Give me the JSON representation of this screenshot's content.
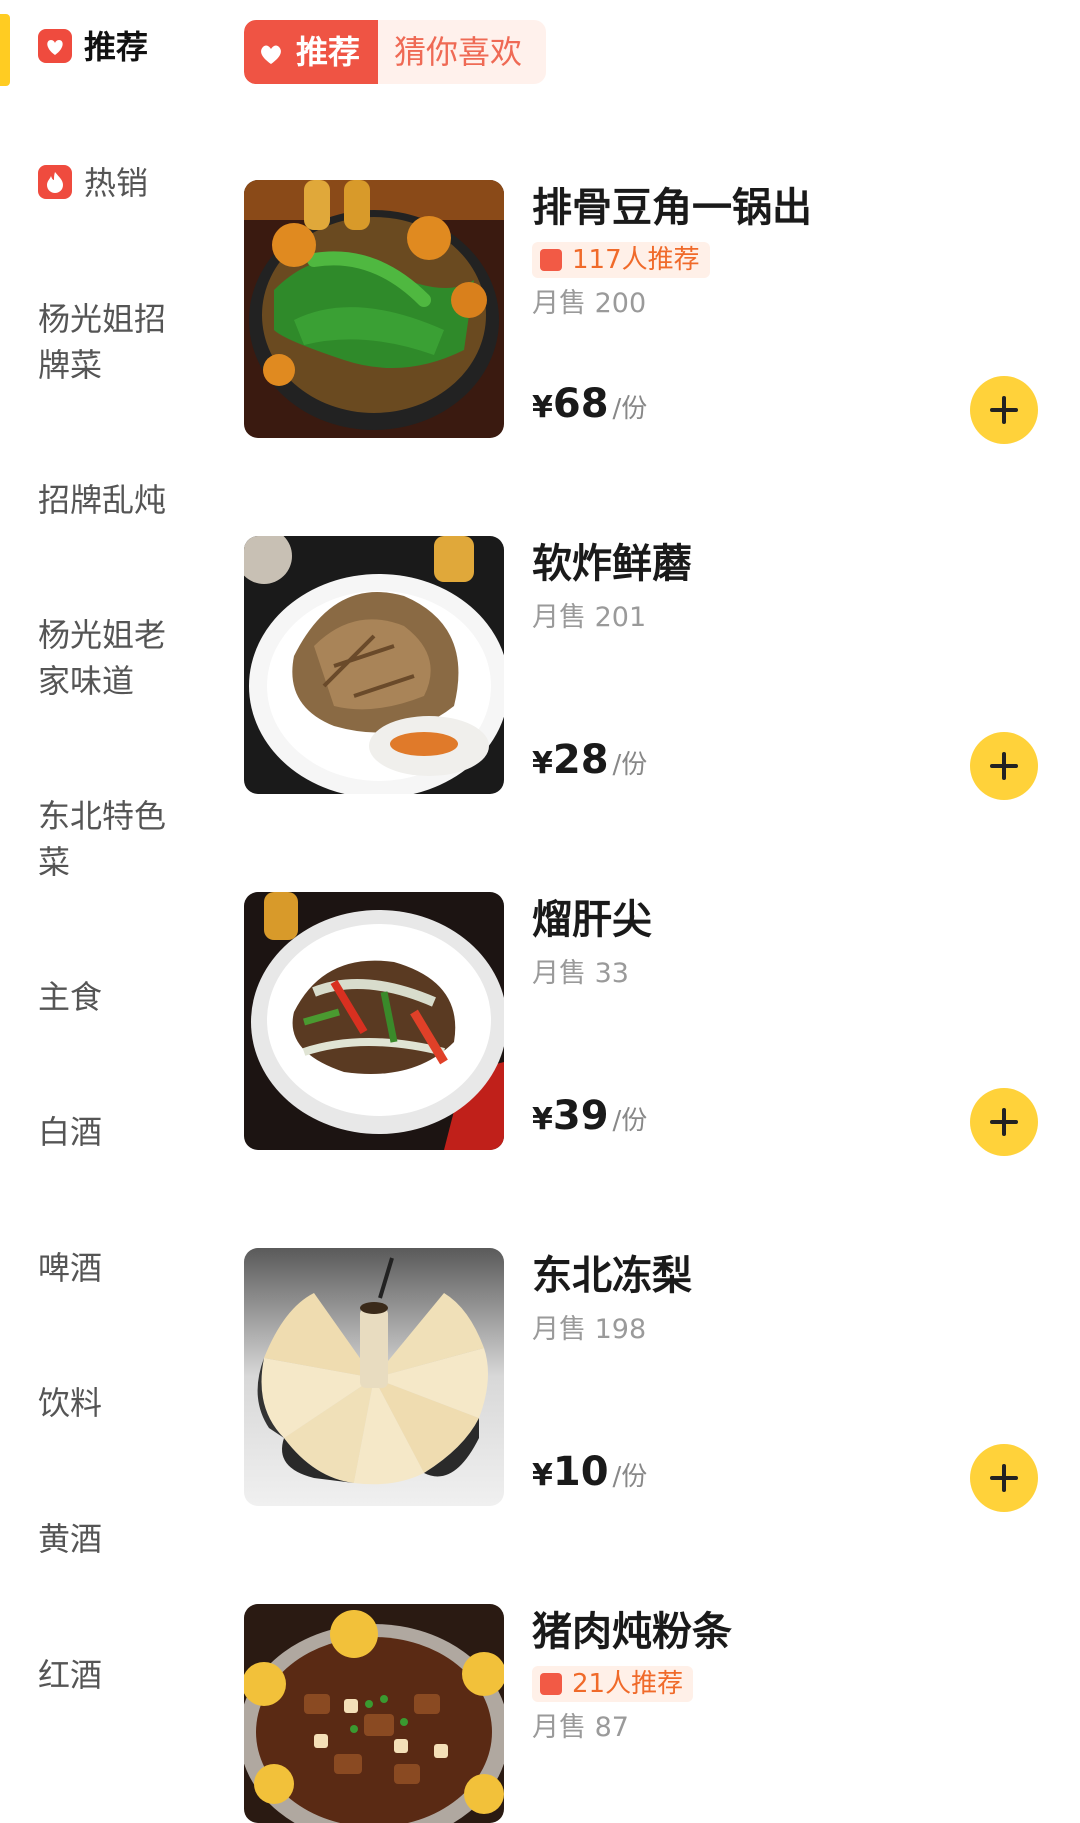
{
  "sidebar": {
    "items": [
      {
        "label": "推荐",
        "icon": "heart-icon",
        "active": true
      },
      {
        "label": "热销",
        "icon": "flame-icon",
        "active": false
      },
      {
        "label": "杨光姐招\n牌菜"
      },
      {
        "label": "招牌乱炖"
      },
      {
        "label": "杨光姐老\n家味道"
      },
      {
        "label": "东北特色\n菜"
      },
      {
        "label": "主食"
      },
      {
        "label": "白酒"
      },
      {
        "label": "啤酒"
      },
      {
        "label": "饮料"
      },
      {
        "label": "黄酒"
      },
      {
        "label": "红酒"
      }
    ]
  },
  "section_tag": {
    "primary": "推荐",
    "secondary": "猜你喜欢",
    "icon": "heart-icon"
  },
  "products": [
    {
      "name": "排骨豆角一锅出",
      "recommend": "117人推荐",
      "sales": "月售 200",
      "currency": "¥",
      "price": "68",
      "unit": "/份"
    },
    {
      "name": "软炸鲜蘑",
      "sales": "月售 201",
      "currency": "¥",
      "price": "28",
      "unit": "/份"
    },
    {
      "name": "熘肝尖",
      "sales": "月售 33",
      "currency": "¥",
      "price": "39",
      "unit": "/份"
    },
    {
      "name": "东北冻梨",
      "sales": "月售 198",
      "currency": "¥",
      "price": "10",
      "unit": "/份"
    },
    {
      "name": "猪肉炖粉条",
      "recommend": "21人推荐",
      "sales": "月售 87"
    }
  ],
  "colors": {
    "accent_yellow": "#ffd23a",
    "accent_red": "#ef5444",
    "indicator": "#ffcc22"
  }
}
